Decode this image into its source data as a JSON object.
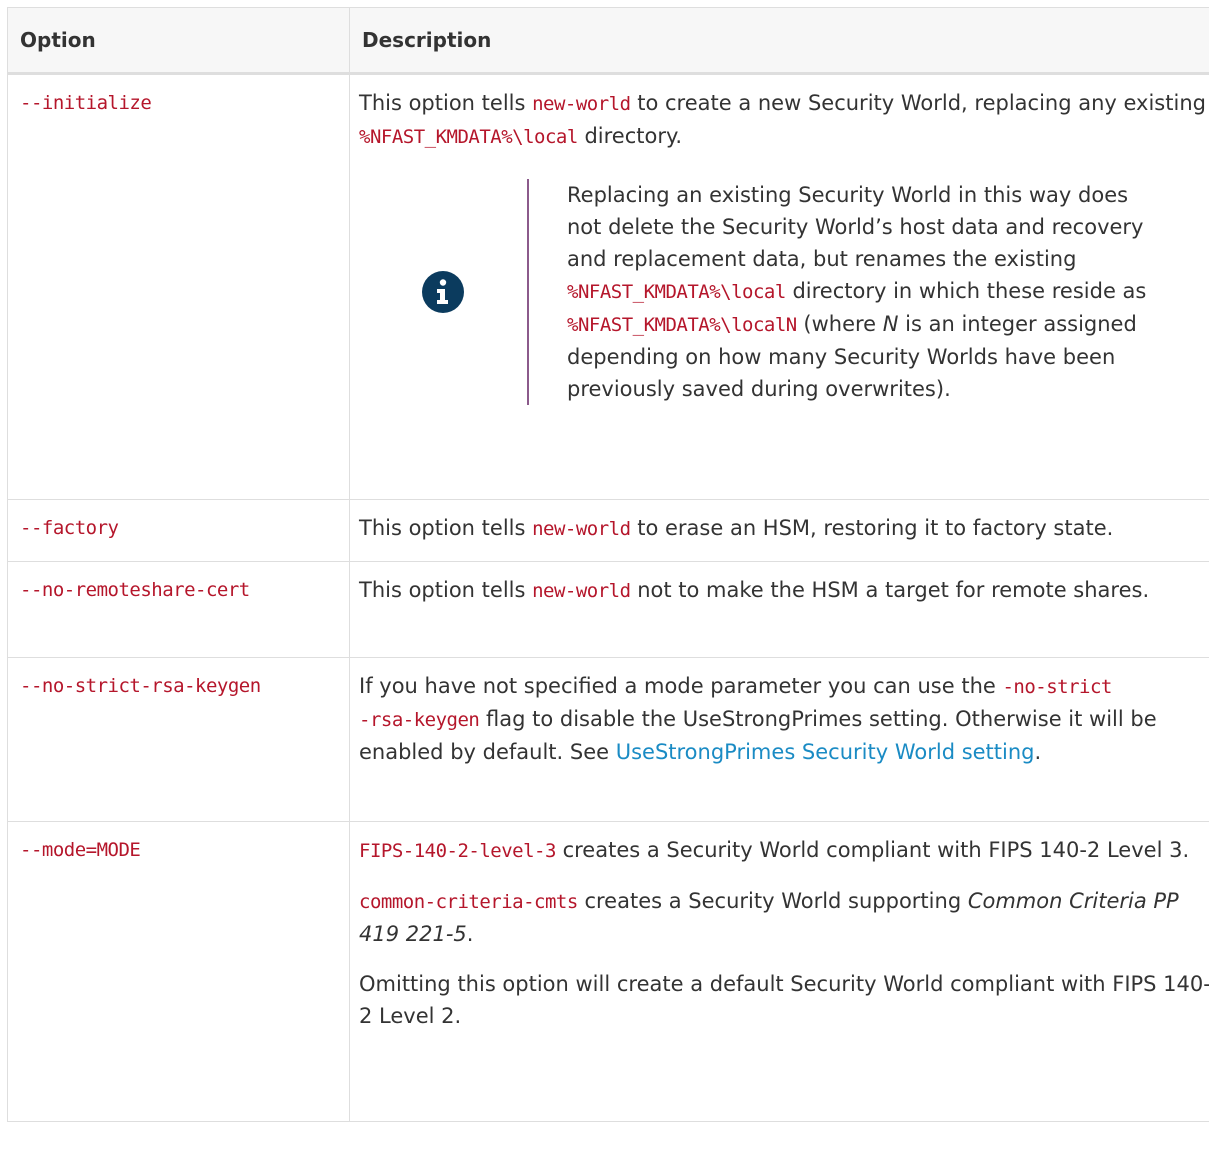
{
  "table": {
    "headers": {
      "option": "Option",
      "description": "Description"
    },
    "rows": {
      "initialize": {
        "option": "--initialize",
        "p1": {
          "t1": "This option tells ",
          "c1": "new-world",
          "t2": " to create a new Security World, replacing any existing ",
          "c2": "%NFAST_KMDATA%\\local",
          "t3": " directory."
        },
        "note": {
          "icon": "info-icon",
          "t1": "Replacing an existing Security World in this way does not delete the Security World’s host data and recovery and replacement data, but renames the existing ",
          "c1": "%NFAST_KMDATA%\\local",
          "t2": " directory in which these reside as ",
          "c2": "%NFAST_KMDATA%\\localN",
          "t3": " (where ",
          "em": "N",
          "t4": " is an integer assigned depending on how many Security Worlds have been previously saved during overwrites)."
        }
      },
      "factory": {
        "option": "--factory",
        "t1": "This option tells ",
        "c1": "new-world",
        "t2": " to erase an HSM, restoring it to factory state."
      },
      "no_remoteshare": {
        "option": "--no-remoteshare-cert",
        "t1": "This option tells ",
        "c1": "new-world",
        "t2": " not to make the HSM a target for remote shares."
      },
      "no_strict": {
        "option": "--no-strict-rsa-keygen",
        "t1": "If you have not specified a mode parameter you can use the ",
        "c1a": "-no-strict",
        "c1b": "-rsa-keygen",
        "t2": " flag to disable the UseStrongPrimes setting. Otherwise it will be enabled by default. See ",
        "link": "UseStrongPrimes Security World setting",
        "t3": "."
      },
      "mode": {
        "option": "--mode=MODE",
        "p1": {
          "c1": "FIPS-140-2-level-3",
          "t1": " creates a Security World compliant with FIPS 140-2 Level 3."
        },
        "p2": {
          "c1": "common-criteria-cmts",
          "t1": " creates a Security World supporting ",
          "em": "Common Criteria PP 419 221-5",
          "t2": "."
        },
        "p3": "Omitting this option will create a default Security World compliant with FIPS 140-2 Level 2."
      }
    }
  }
}
